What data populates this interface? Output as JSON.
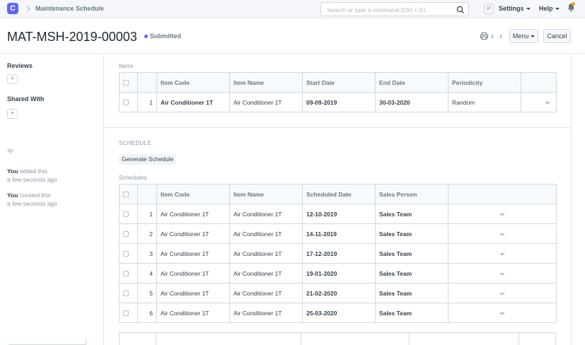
{
  "navbar": {
    "logo": "C",
    "breadcrumb": "Maintenance Schedule",
    "search_placeholder": "Search or type a command (Ctrl + G)",
    "avatar_letter": "P",
    "settings": "Settings",
    "help": "Help"
  },
  "page": {
    "title": "MAT-MSH-2019-00003",
    "status": "Submitted",
    "menu_label": "Menu",
    "cancel_label": "Cancel"
  },
  "sidebar": {
    "reviews": "Reviews",
    "shared_with": "Shared With",
    "activity": [
      {
        "user": "You",
        "action": "edited this",
        "time": "a few seconds ago"
      },
      {
        "user": "You",
        "action": "created this",
        "time": "a few seconds ago"
      }
    ]
  },
  "items_section": {
    "label": "Items",
    "columns": [
      "Item Code",
      "Item Name",
      "Start Date",
      "End Date",
      "Periodicity"
    ],
    "rows": [
      {
        "idx": "1",
        "item_code": "Air Conditioner 1T",
        "item_name": "Air Conditioner 1T",
        "start_date": "09-09-2019",
        "end_date": "30-03-2020",
        "periodicity": "Random"
      }
    ]
  },
  "schedule_section": {
    "heading": "SCHEDULE",
    "generate_button": "Generate Schedule",
    "label": "Schedules",
    "columns": [
      "Item Code",
      "Item Name",
      "Scheduled Date",
      "Sales Person"
    ],
    "rows": [
      {
        "idx": "1",
        "item_code": "Air Conditioner 1T",
        "item_name": "Air Conditioner 1T",
        "scheduled_date": "12-10-2019",
        "sales_person": "Sales Team"
      },
      {
        "idx": "2",
        "item_code": "Air Conditioner 1T",
        "item_name": "Air Conditioner 1T",
        "scheduled_date": "14-11-2019",
        "sales_person": "Sales Team"
      },
      {
        "idx": "3",
        "item_code": "Air Conditioner 1T",
        "item_name": "Air Conditioner 1T",
        "scheduled_date": "17-12-2019",
        "sales_person": "Sales Team"
      },
      {
        "idx": "4",
        "item_code": "Air Conditioner 1T",
        "item_name": "Air Conditioner 1T",
        "scheduled_date": "19-01-2020",
        "sales_person": "Sales Team"
      },
      {
        "idx": "5",
        "item_code": "Air Conditioner 1T",
        "item_name": "Air Conditioner 1T",
        "scheduled_date": "21-02-2020",
        "sales_person": "Sales Team"
      },
      {
        "idx": "6",
        "item_code": "Air Conditioner 1T",
        "item_name": "Air Conditioner 1T",
        "scheduled_date": "25-03-2020",
        "sales_person": "Sales Team"
      }
    ]
  },
  "colors": {
    "accent": "#5e64ff",
    "notification": "#ffa00a"
  }
}
